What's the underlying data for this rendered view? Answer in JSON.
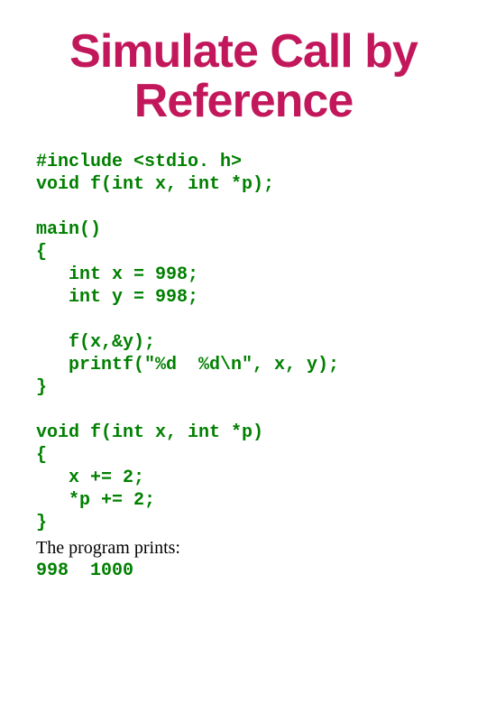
{
  "title": "Simulate Call by Reference",
  "code_lines": {
    "l1": "#include <stdio. h>",
    "l2": "void f(int x, int *p);",
    "l3": "",
    "l4": "main()",
    "l5": "{",
    "l6": "   int x = 998;",
    "l7": "   int y = 998;",
    "l8": "",
    "l9": "   f(x,&y);",
    "l10": "   printf(\"%d  %d\\n\", x, y);",
    "l11": "}",
    "l12": "",
    "l13": "void f(int x, int *p)",
    "l14": "{",
    "l15": "   x += 2;",
    "l16": "   *p += 2;",
    "l17": "}"
  },
  "caption": "The program prints:",
  "output": "998  1000"
}
